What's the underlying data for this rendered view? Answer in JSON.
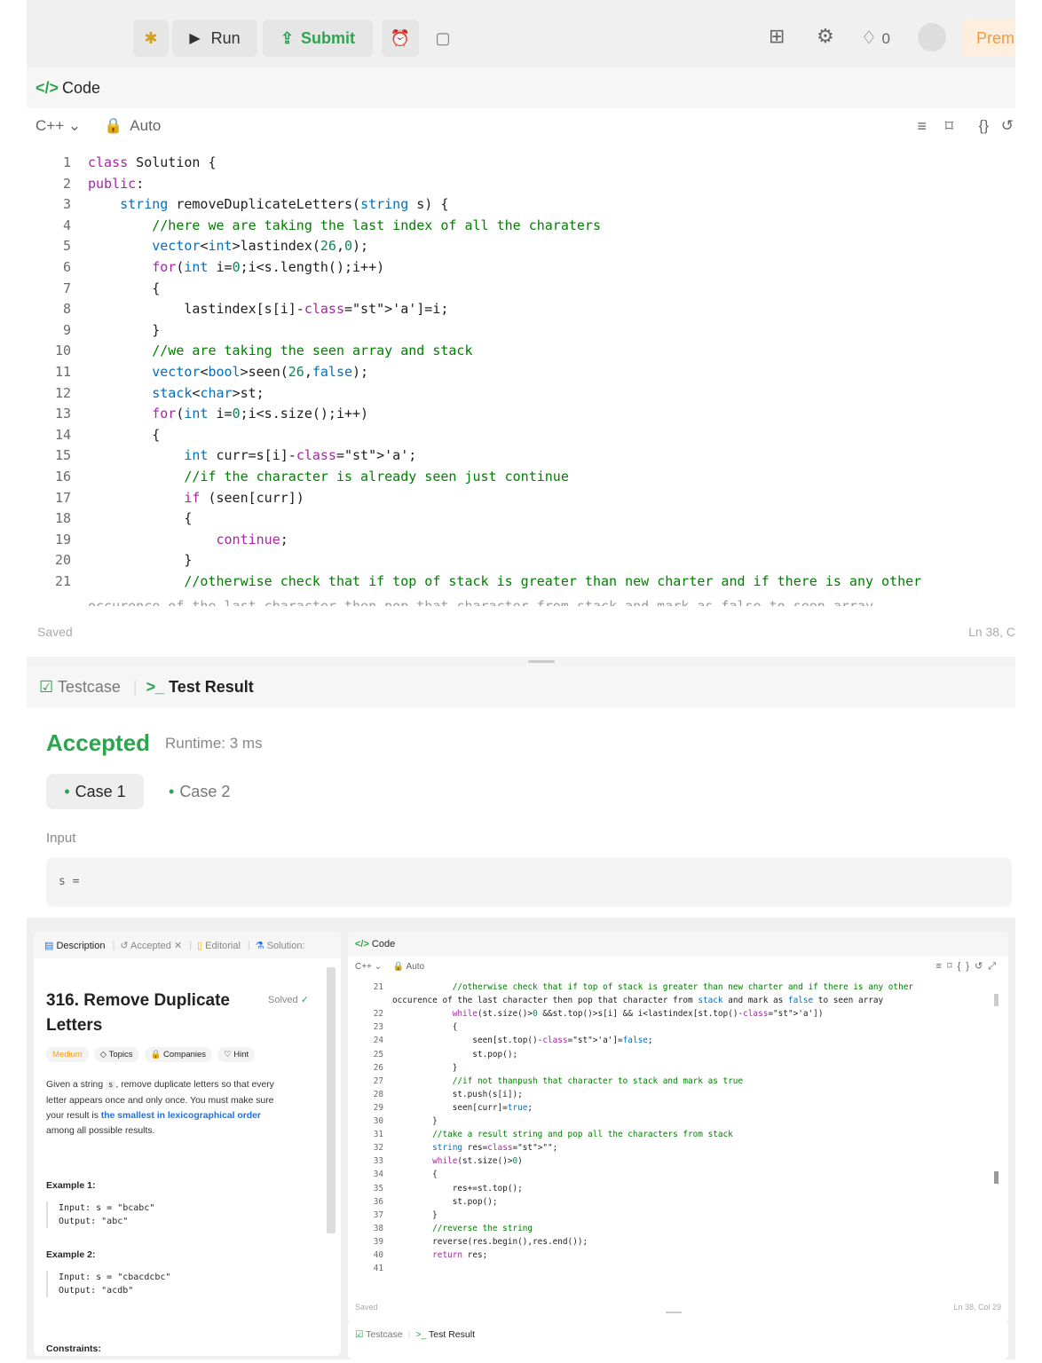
{
  "toolbar": {
    "run_label": "Run",
    "submit_label": "Submit",
    "fire_count": "0",
    "premium_label": "Prem"
  },
  "editor": {
    "header_title": "Code",
    "language": "C++",
    "mode": "Auto",
    "saved_label": "Saved",
    "cursor_pos": "Ln 38, C",
    "lines": [
      "class Solution {",
      "public:",
      "    string removeDuplicateLetters(string s) {",
      "        //here we are taking the last index of all the charaters",
      "        vector<int>lastindex(26,0);",
      "        for(int i=0;i<s.length();i++)",
      "        {",
      "            lastindex[s[i]-'a']=i;",
      "        }",
      "        //we are taking the seen array and stack",
      "        vector<bool>seen(26,false);",
      "        stack<char>st;",
      "        for(int i=0;i<s.size();i++)",
      "        {",
      "            int curr=s[i]-'a';",
      "            //if the character is already seen just continue",
      "            if (seen[curr])",
      "            {",
      "                continue;",
      "            }",
      "            //otherwise check that if top of stack is greater than new charter and if there is any other"
    ],
    "line_numbers": [
      "1",
      "2",
      "3",
      "4",
      "5",
      "6",
      "7",
      "8",
      "9",
      "10",
      "11",
      "12",
      "13",
      "14",
      "15",
      "16",
      "17",
      "18",
      "19",
      "20",
      "21"
    ]
  },
  "result": {
    "tab_testcase": "Testcase",
    "tab_test_result": "Test Result",
    "status": "Accepted",
    "runtime": "Runtime: 3 ms",
    "case1": "Case 1",
    "case2": "Case 2",
    "input_label": "Input",
    "input_var": "s ="
  },
  "problem": {
    "tabs": [
      "Description",
      "Accepted",
      "Editorial",
      "Solution:"
    ],
    "title_line1": "316. Remove Duplicate",
    "title_line2": "Letters",
    "solved_label": "Solved",
    "tags": [
      "Medium",
      "Topics",
      "Companies",
      "Hint"
    ],
    "desc_1": "Given a string ",
    "desc_var": "s",
    "desc_2": ", remove duplicate letters so that every",
    "desc_3": "letter appears once and only once. You must make sure",
    "desc_4": "your result is ",
    "desc_link": "the smallest in lexicographical order",
    "desc_5": "among all possible results.",
    "example1_title": "Example 1:",
    "example1_input": "Input: s = \"bcabc\"",
    "example1_output": "Output: \"abc\"",
    "example2_title": "Example 2:",
    "example2_input": "Input: s = \"cbacdcbc\"",
    "example2_output": "Output: \"acdb\"",
    "constraints_title": "Constraints:"
  },
  "editor2": {
    "header_title": "Code",
    "language": "C++",
    "mode": "Auto",
    "saved_label": "Saved",
    "cursor_pos": "Ln 38, Col 29",
    "tab_testcase": "Testcase",
    "tab_test_result": "Test Result",
    "line_numbers": [
      "21",
      "",
      "22",
      "23",
      "24",
      "25",
      "26",
      "27",
      "28",
      "29",
      "30",
      "31",
      "32",
      "33",
      "34",
      "35",
      "36",
      "37",
      "38",
      "39",
      "40",
      "41"
    ],
    "lines": [
      "            //otherwise check that if top of stack is greater than new charter and if there is any other",
      "occurence of the last character then pop that character from stack and mark as false to seen array",
      "            while(st.size()>0 &&st.top()>s[i] && i<lastindex[st.top()-'a'])",
      "            {",
      "                seen[st.top()-'a']=false;",
      "                st.pop();",
      "            }",
      "            //if not thanpush that character to stack and mark as true",
      "            st.push(s[i]);",
      "            seen[curr]=true;",
      "        }",
      "        //take a result string and pop all the characters from stack",
      "        string res=\"\";",
      "        while(st.size()>0)",
      "        {",
      "            res+=st.top();",
      "            st.pop();",
      "        }",
      "        //reverse the string",
      "        reverse(res.begin(),res.end());",
      "        return res;",
      ""
    ]
  }
}
